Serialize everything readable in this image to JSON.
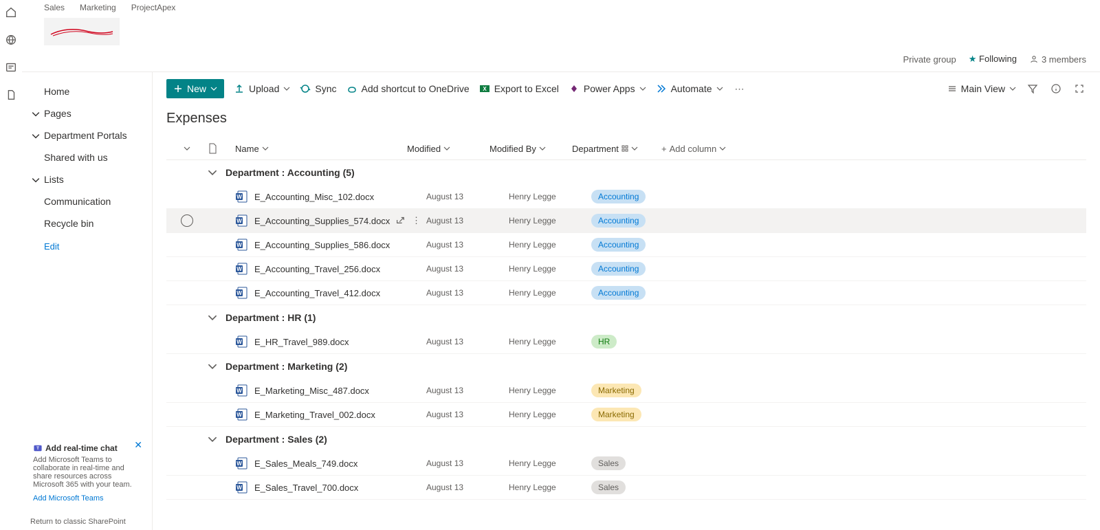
{
  "topTabs": [
    "Sales",
    "Marketing",
    "ProjectApex"
  ],
  "headerInfo": {
    "privateGroup": "Private group",
    "following": "Following",
    "members": "3 members"
  },
  "nav": {
    "home": "Home",
    "pages": "Pages",
    "deptPortals": "Department Portals",
    "shared": "Shared with us",
    "lists": "Lists",
    "communication": "Communication",
    "recycle": "Recycle bin",
    "edit": "Edit"
  },
  "promo": {
    "title": "Add real-time chat",
    "body": "Add Microsoft Teams to collaborate in real-time and share resources across Microsoft 365 with your team.",
    "link": "Add Microsoft Teams"
  },
  "returnLink": "Return to classic SharePoint",
  "cmdbar": {
    "new": "New",
    "upload": "Upload",
    "sync": "Sync",
    "shortcut": "Add shortcut to OneDrive",
    "export": "Export to Excel",
    "powerapps": "Power Apps",
    "automate": "Automate",
    "mainView": "Main View"
  },
  "listTitle": "Expenses",
  "columns": {
    "name": "Name",
    "modified": "Modified",
    "modifiedBy": "Modified By",
    "department": "Department",
    "addColumn": "Add column"
  },
  "groups": [
    {
      "label": "Department : Accounting (5)",
      "badgeClass": "badge-accounting",
      "badgeText": "Accounting",
      "rows": [
        {
          "name": "E_Accounting_Misc_102.docx",
          "modified": "August 13",
          "modifiedBy": "Henry Legge"
        },
        {
          "name": "E_Accounting_Supplies_574.docx",
          "modified": "August 13",
          "modifiedBy": "Henry Legge",
          "hovered": true
        },
        {
          "name": "E_Accounting_Supplies_586.docx",
          "modified": "August 13",
          "modifiedBy": "Henry Legge"
        },
        {
          "name": "E_Accounting_Travel_256.docx",
          "modified": "August 13",
          "modifiedBy": "Henry Legge"
        },
        {
          "name": "E_Accounting_Travel_412.docx",
          "modified": "August 13",
          "modifiedBy": "Henry Legge"
        }
      ]
    },
    {
      "label": "Department : HR (1)",
      "badgeClass": "badge-hr",
      "badgeText": "HR",
      "rows": [
        {
          "name": "E_HR_Travel_989.docx",
          "modified": "August 13",
          "modifiedBy": "Henry Legge"
        }
      ]
    },
    {
      "label": "Department : Marketing (2)",
      "badgeClass": "badge-marketing",
      "badgeText": "Marketing",
      "rows": [
        {
          "name": "E_Marketing_Misc_487.docx",
          "modified": "August 13",
          "modifiedBy": "Henry Legge"
        },
        {
          "name": "E_Marketing_Travel_002.docx",
          "modified": "August 13",
          "modifiedBy": "Henry Legge"
        }
      ]
    },
    {
      "label": "Department : Sales (2)",
      "badgeClass": "badge-sales",
      "badgeText": "Sales",
      "rows": [
        {
          "name": "E_Sales_Meals_749.docx",
          "modified": "August 13",
          "modifiedBy": "Henry Legge"
        },
        {
          "name": "E_Sales_Travel_700.docx",
          "modified": "August 13",
          "modifiedBy": "Henry Legge"
        }
      ]
    }
  ]
}
